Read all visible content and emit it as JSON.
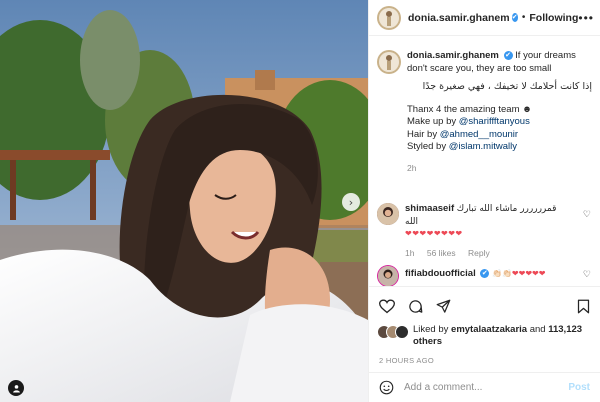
{
  "header": {
    "username": "donia.samir.ghanem",
    "follow_label": "Following",
    "separator": "•",
    "more_label": "•••",
    "verified_mark": "✔"
  },
  "caption": {
    "username": "donia.samir.ghanem",
    "text": "If your dreams don't scare you, they are too small",
    "arabic": "إذا كانت أحلامك لا تخيفك ، فهي صغيرة جدًا",
    "thanks": "Thanx 4 the amazing team",
    "thanks_emoji": "☻",
    "makeup_prefix": "Make up by ",
    "makeup_handle": "@shariffftanyous",
    "hair_prefix": "Hair by ",
    "hair_handle": "@ahmed__mounir",
    "styled_prefix": "Styled by ",
    "styled_handle": "@islam.mitwally",
    "time": "2h"
  },
  "comments": [
    {
      "username": "shimaaseif",
      "text": "قمرررررر ماشاء الله تبارك الله",
      "hearts": "❤❤❤❤❤❤❤❤",
      "time": "1h",
      "likes": "56 likes",
      "reply": "Reply"
    },
    {
      "username": "fifiabdouofficial",
      "text": "👏🏻👏🏻❤❤❤❤❤"
    }
  ],
  "actions": {
    "like_icon": "heart-icon",
    "comment_icon": "comment-icon",
    "share_icon": "share-icon",
    "save_icon": "bookmark-icon"
  },
  "likes": {
    "prefix": "Liked by ",
    "user": "emytalaatzakaria",
    "middle": " and ",
    "count": "113,123 others"
  },
  "post_time": "2 HOURS AGO",
  "add_comment": {
    "placeholder": "Add a comment...",
    "post_label": "Post"
  },
  "media": {
    "pager_glyph": "›"
  },
  "colors": {
    "verified": "#3897f0",
    "link": "#00376b",
    "post_button": "#b2dffc",
    "muted": "#8e8e8e"
  }
}
